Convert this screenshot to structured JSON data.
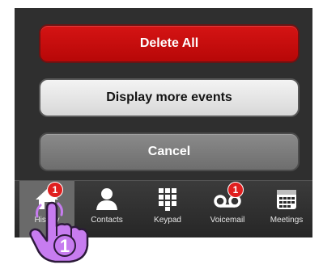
{
  "action_sheet": {
    "delete_all_label": "Delete All",
    "display_more_label": "Display more events",
    "cancel_label": "Cancel"
  },
  "tabbar": {
    "tabs": [
      {
        "label": "History",
        "icon": "home-icon",
        "badge": "1",
        "selected": true
      },
      {
        "label": "Contacts",
        "icon": "contacts-icon"
      },
      {
        "label": "Keypad",
        "icon": "keypad-icon"
      },
      {
        "label": "Voicemail",
        "icon": "voicemail-icon",
        "badge": "1"
      },
      {
        "label": "Meetings",
        "icon": "meetings-icon"
      }
    ]
  },
  "annotation": {
    "step_number": "1"
  },
  "colors": {
    "delete": "#c50d0d",
    "badge": "#e01f1f",
    "pointer": "#c77cf0"
  }
}
